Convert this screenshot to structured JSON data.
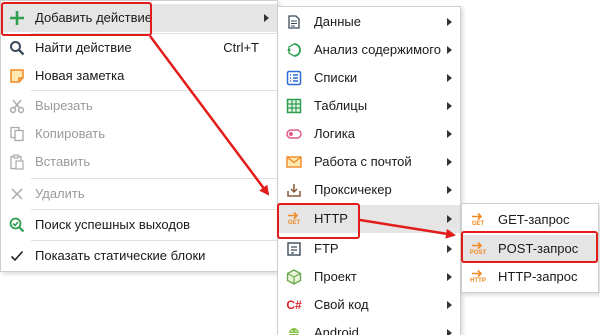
{
  "main_menu": {
    "items": [
      {
        "label": "Добавить действие",
        "icon": "plus-icon",
        "has_submenu": true,
        "disabled": false
      },
      {
        "label": "Найти действие",
        "icon": "search-icon",
        "shortcut": "Ctrl+T",
        "disabled": false
      },
      {
        "label": "Новая заметка",
        "icon": "note-icon",
        "disabled": false
      },
      {
        "label": "Вырезать",
        "icon": "scissors-icon",
        "disabled": true
      },
      {
        "label": "Копировать",
        "icon": "copy-icon",
        "disabled": true
      },
      {
        "label": "Вставить",
        "icon": "paste-icon",
        "disabled": true
      },
      {
        "label": "Удалить",
        "icon": "delete-icon",
        "disabled": true
      },
      {
        "label": "Поиск успешных выходов",
        "icon": "search-success-icon",
        "disabled": false
      },
      {
        "label": "Показать статические блоки",
        "icon": "checkmark-icon",
        "disabled": false
      }
    ]
  },
  "actions_submenu": {
    "items": [
      {
        "label": "Данные",
        "icon": "data-icon",
        "has_submenu": true
      },
      {
        "label": "Анализ содержимого",
        "icon": "content-analysis-icon",
        "has_submenu": true
      },
      {
        "label": "Списки",
        "icon": "lists-icon",
        "has_submenu": true
      },
      {
        "label": "Таблицы",
        "icon": "tables-icon",
        "has_submenu": true
      },
      {
        "label": "Логика",
        "icon": "logic-icon",
        "has_submenu": true
      },
      {
        "label": "Работа с почтой",
        "icon": "mail-icon",
        "has_submenu": true
      },
      {
        "label": "Проксичекер",
        "icon": "proxy-checker-icon",
        "has_submenu": true
      },
      {
        "label": "HTTP",
        "icon": "http-icon",
        "icon_text": "GET",
        "has_submenu": true
      },
      {
        "label": "FTP",
        "icon": "ftp-icon",
        "has_submenu": true
      },
      {
        "label": "Проект",
        "icon": "project-icon",
        "has_submenu": true
      },
      {
        "label": "Свой код",
        "icon": "csharp-icon",
        "icon_text": "C#",
        "has_submenu": true
      },
      {
        "label": "Android",
        "icon": "android-icon",
        "has_submenu": true
      }
    ]
  },
  "http_submenu": {
    "items": [
      {
        "label": "GET-запрос",
        "icon": "get-request-icon",
        "icon_text": "GET"
      },
      {
        "label": "POST-запрос",
        "icon": "post-request-icon",
        "icon_text": "POST"
      },
      {
        "label": "HTTP-запрос",
        "icon": "http-request-icon",
        "icon_text": "HTTP"
      }
    ]
  },
  "colors": {
    "annotation_red": "#e21b1b",
    "highlight": "#e5e5e5",
    "icon_green": "#2e9e4f",
    "icon_orange": "#f08a24",
    "icon_blue": "#2b6cd6"
  }
}
